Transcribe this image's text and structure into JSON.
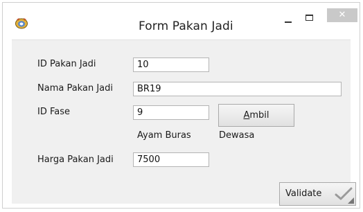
{
  "window": {
    "title": "Form Pakan Jadi",
    "close_glyph": "✕"
  },
  "form": {
    "id_pakan_jadi": {
      "label": "ID Pakan Jadi",
      "value": "10"
    },
    "nama_pakan_jadi": {
      "label": "Nama Pakan Jadi",
      "value": "BR19"
    },
    "id_fase": {
      "label": "ID Fase",
      "value": "9"
    },
    "ambil_button": {
      "label_mnemonic": "A",
      "label_rest": "mbil"
    },
    "fase_info": {
      "jenis": "Ayam Buras",
      "fase": "Dewasa"
    },
    "harga_pakan_jadi": {
      "label": "Harga Pakan Jadi",
      "value": "7500"
    },
    "validate_button": {
      "label": "Validate"
    }
  },
  "icons": {
    "app": "app-icon",
    "check": "check-icon"
  },
  "colors": {
    "client_background": "#f0f0f0",
    "close_button": "#c9c9c9",
    "textbox_border": "#b4b4b4"
  }
}
